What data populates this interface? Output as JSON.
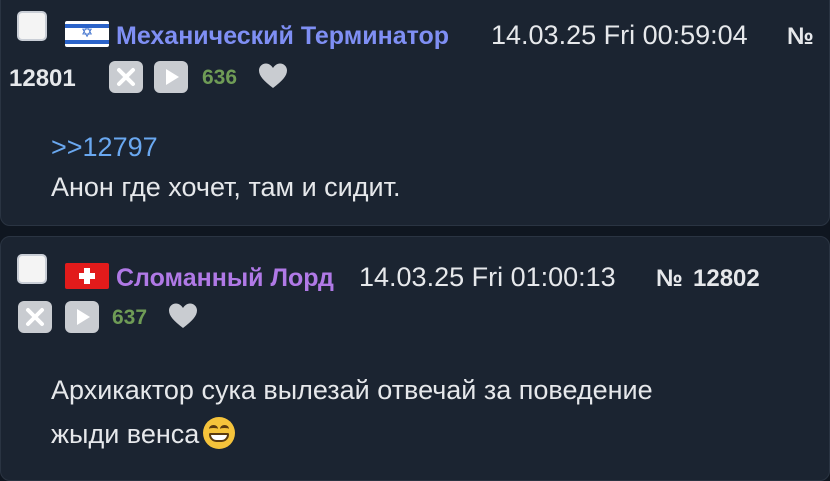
{
  "posts": [
    {
      "name": "Механический Терминатор",
      "flag": "israel-flag",
      "datetime": "14.03.25 Fri 00:59:04",
      "number_sign": "№",
      "number": "12801",
      "likes": "636",
      "reply_link": ">>12797",
      "text": "Анон где хочет, там и сидит."
    },
    {
      "name": "Сломанный Лорд",
      "flag": "switzerland-flag",
      "datetime": "14.03.25 Fri 01:00:13",
      "number_sign": "№",
      "number": "12802",
      "likes": "637",
      "text_line1": "Архикактор сука вылезай отвечай за поведение",
      "text_line2": "жыди венса",
      "emoji": "grinning-face-emoji"
    }
  ],
  "colors": {
    "background": "#0f1620",
    "post_background": "#1b2431",
    "name1": "#7f8ff4",
    "name2": "#b079e6",
    "reply_link": "#6aa8f0",
    "likes": "#6f9c56"
  }
}
